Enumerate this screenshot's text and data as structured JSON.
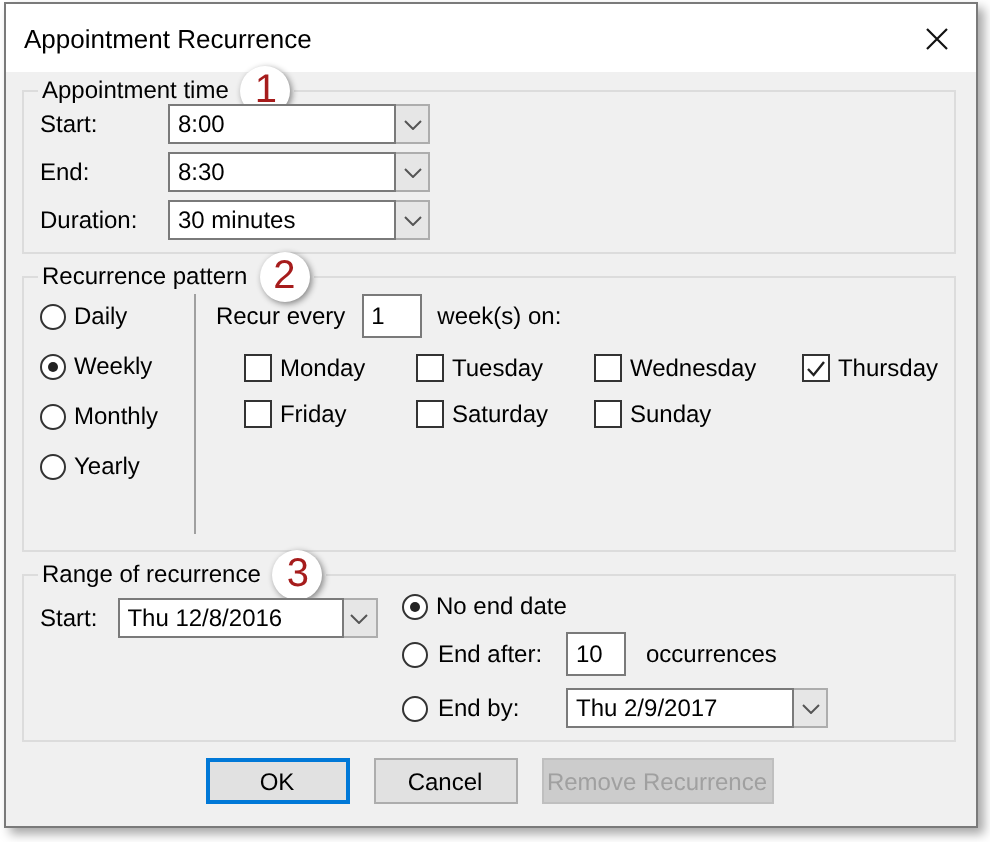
{
  "window": {
    "title": "Appointment Recurrence"
  },
  "appointment_time": {
    "legend": "Appointment time",
    "callout": "1",
    "fields": [
      {
        "label": "Start:",
        "value": "8:00"
      },
      {
        "label": "End:",
        "value": "8:30"
      },
      {
        "label": "Duration:",
        "value": "30 minutes"
      }
    ]
  },
  "recurrence_pattern": {
    "legend": "Recurrence pattern",
    "callout": "2",
    "frequencies": [
      {
        "label": "Daily",
        "selected": false
      },
      {
        "label": "Weekly",
        "selected": true
      },
      {
        "label": "Monthly",
        "selected": false
      },
      {
        "label": "Yearly",
        "selected": false
      }
    ],
    "recur_every_label": "Recur every",
    "interval": "1",
    "interval_suffix": "week(s) on:",
    "days": [
      {
        "label": "Monday",
        "checked": false
      },
      {
        "label": "Tuesday",
        "checked": false
      },
      {
        "label": "Wednesday",
        "checked": false
      },
      {
        "label": "Thursday",
        "checked": true
      },
      {
        "label": "Friday",
        "checked": false
      },
      {
        "label": "Saturday",
        "checked": false
      },
      {
        "label": "Sunday",
        "checked": false
      }
    ]
  },
  "range_of_recurrence": {
    "legend": "Range of recurrence",
    "callout": "3",
    "start_label": "Start:",
    "start_value": "Thu 12/8/2016",
    "end_options": [
      {
        "kind": "none",
        "label": "No end date",
        "selected": true
      },
      {
        "kind": "after",
        "label": "End after:",
        "value": "10",
        "suffix": "occurrences",
        "selected": false
      },
      {
        "kind": "by",
        "label": "End by:",
        "value": "Thu 2/9/2017",
        "selected": false
      }
    ]
  },
  "buttons": [
    {
      "label": "OK",
      "default": true,
      "disabled": false
    },
    {
      "label": "Cancel",
      "default": false,
      "disabled": false
    },
    {
      "label": "Remove Recurrence",
      "default": false,
      "disabled": true
    }
  ]
}
